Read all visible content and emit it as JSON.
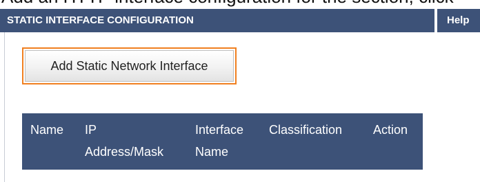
{
  "heading_fragment": "Add an HTTP interface configuration for the section, click",
  "panel": {
    "title": "STATIC INTERFACE CONFIGURATION",
    "help_label": "Help"
  },
  "add_button_label": "Add Static Network Interface",
  "table": {
    "columns": [
      {
        "line1": "Name",
        "line2": ""
      },
      {
        "line1": "IP",
        "line2": "Address/Mask"
      },
      {
        "line1": "Interface",
        "line2": "Name"
      },
      {
        "line1": "Classification",
        "line2": ""
      },
      {
        "line1": "Action",
        "line2": ""
      }
    ]
  },
  "colors": {
    "header_bg": "#3d5278",
    "header_text": "#ffffff",
    "focus_outline": "#f07f1f"
  }
}
